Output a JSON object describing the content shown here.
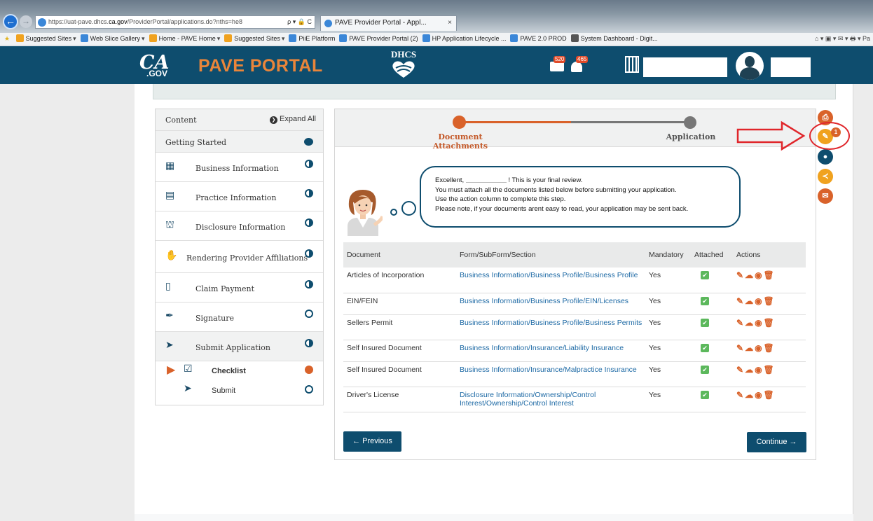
{
  "browser": {
    "url_prefix": "https://uat-pave.dhcs.",
    "url_domain": "ca.gov",
    "url_rest": "/ProviderPortal/applications.do?nths=he8",
    "addr_controls": "ρ ▾ 🔒 C",
    "tab_title": "PAVE Provider Portal - Appl...",
    "tab_close": "×",
    "favorites": [
      {
        "label": "Suggested Sites",
        "color": "#f0a21f"
      },
      {
        "label": "Web Slice Gallery",
        "color": "#3b87d8"
      },
      {
        "label": "Home - PAVE Home",
        "color": "#f0a21f"
      },
      {
        "label": "Suggested Sites",
        "color": "#f0a21f"
      },
      {
        "label": "PiiE Platform",
        "color": "#3b87d8"
      },
      {
        "label": "PAVE Provider Portal (2)",
        "color": "#3b87d8"
      },
      {
        "label": "HP Application Lifecycle ...",
        "color": "#3b87d8"
      },
      {
        "label": "PAVE 2.0 PROD",
        "color": "#3b87d8"
      },
      {
        "label": "System Dashboard - Digit...",
        "color": "#555555"
      }
    ],
    "fav_tools": "⌂ ▾ ▣ ▾ ✉ ▾ 🖶 ▾ Pa"
  },
  "header": {
    "ca_logo": "CA",
    "ca_gov": ".GOV",
    "title": "PAVE PORTAL",
    "dhcs": "DHCS",
    "mail_count": "520",
    "notif_count": "465"
  },
  "sidebar": {
    "title": "Content",
    "expand_all": "Expand All",
    "getting_started": "Getting Started",
    "items": [
      {
        "label": "Business Information",
        "icon": "▦",
        "icon_name": "building-icon",
        "status": "half"
      },
      {
        "label": "Practice Information",
        "icon": "▤",
        "icon_name": "document-icon",
        "status": "half"
      },
      {
        "label": "Disclosure Information",
        "icon": "⛫",
        "icon_name": "disclosure-icon",
        "status": "half"
      },
      {
        "label": "Rendering Provider Affiliations",
        "icon": "✋",
        "icon_name": "handshake-icon",
        "status": "half"
      },
      {
        "label": "Claim Payment",
        "icon": "▯",
        "icon_name": "claim-icon",
        "status": "half"
      },
      {
        "label": "Signature",
        "icon": "✒",
        "icon_name": "pen-icon",
        "status": "empty"
      },
      {
        "label": "Submit Application",
        "icon": "➤",
        "icon_name": "send-icon",
        "status": "half"
      }
    ],
    "sub_items": [
      {
        "label": "Checklist",
        "icon": "☑",
        "status": "orange"
      },
      {
        "label": "Submit",
        "icon": "➤",
        "status": "empty"
      }
    ]
  },
  "stepper": {
    "step1": "Document Attachments",
    "step2": "Application"
  },
  "message": {
    "greeting_start": "Excellent,",
    "greeting_end": "! This is your final review.",
    "line2": "You must attach all the documents listed below before submitting your application.",
    "line3": "Use the action column to complete this step.",
    "line4": "Please note, if your documents arent easy to read, your application may be sent back."
  },
  "table": {
    "headers": [
      "Document",
      "Form/SubForm/Section",
      "Mandatory",
      "Attached",
      "Actions"
    ],
    "rows": [
      {
        "document": "Articles of Incorporation",
        "section": "Business Information/Business Profile/Business Profile",
        "mandatory": "Yes"
      },
      {
        "document": "EIN/FEIN",
        "section": "Business Information/Business Profile/EIN/Licenses",
        "mandatory": "Yes"
      },
      {
        "document": "Sellers Permit",
        "section": "Business Information/Business Profile/Business Permits",
        "mandatory": "Yes"
      },
      {
        "document": "Self Insured Document",
        "section": "Business Information/Insurance/Liability Insurance",
        "mandatory": "Yes"
      },
      {
        "document": "Self Insured Document",
        "section": "Business Information/Insurance/Malpractice Insurance",
        "mandatory": "Yes"
      },
      {
        "document": "Driver's License",
        "section": "Disclosure Information/Ownership/Control Interest/Ownership/Control Interest",
        "mandatory": "Yes"
      }
    ]
  },
  "buttons": {
    "previous": "← Previous",
    "continue": "Continue →"
  },
  "tools": {
    "attach_badge": "1"
  },
  "colors": {
    "brand_blue": "#0e4d6e",
    "accent_orange": "#d9622a",
    "attached_green": "#5cb85c",
    "highlight_red": "#e0262b"
  }
}
